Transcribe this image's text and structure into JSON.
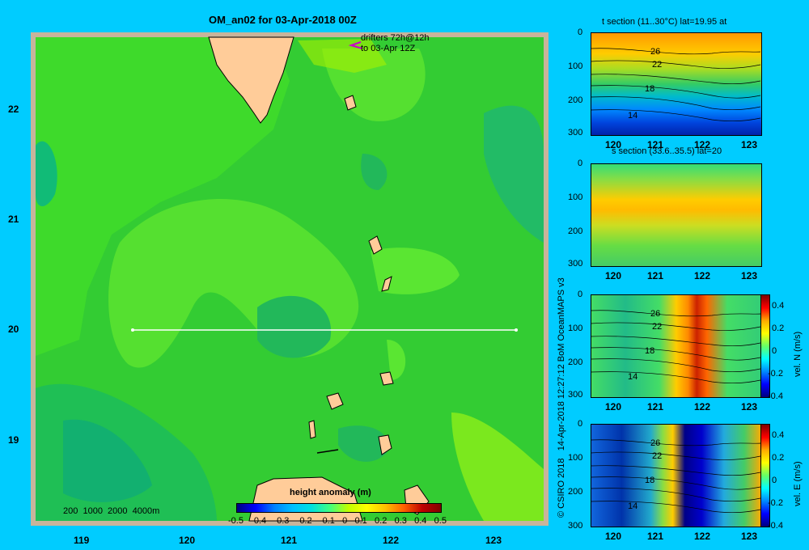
{
  "map": {
    "title": "OM_an02 for 03-Apr-2018 00Z",
    "drifters_line1": "drifters 72h@12h",
    "drifters_line2": "to 03-Apr 12Z",
    "lat_ticks": [
      "22",
      "21",
      "20",
      "19"
    ],
    "lon_ticks": [
      "119",
      "120",
      "121",
      "122",
      "123"
    ],
    "depth_legend": "200  1000  2000  4000m",
    "colorbar_title": "height anomaly (m)",
    "colorbar_ticks": [
      "-0.5",
      "-0.4",
      "-0.3",
      "-0.2",
      "-0.1",
      "0",
      "0.1",
      "0.2",
      "0.3",
      "0.4",
      "0.5"
    ]
  },
  "sections": [
    {
      "title": "t section (11..30°C) lat=19.95 at",
      "depth_ticks": [
        "0",
        "100",
        "200",
        "300"
      ],
      "lon_ticks": [
        "120",
        "121",
        "122",
        "123"
      ],
      "contour_labels": [
        "26",
        "22",
        "18",
        "14"
      ],
      "colorbar": null
    },
    {
      "title": "s section (33.6..35.5) lat=20",
      "depth_ticks": [
        "0",
        "100",
        "200",
        "300"
      ],
      "lon_ticks": [
        "120",
        "121",
        "122",
        "123"
      ],
      "contour_labels": [],
      "colorbar": null
    },
    {
      "title": "",
      "depth_ticks": [
        "0",
        "100",
        "200",
        "300"
      ],
      "lon_ticks": [
        "120",
        "121",
        "122",
        "123"
      ],
      "contour_labels": [
        "26",
        "22",
        "18",
        "14"
      ],
      "colorbar": {
        "label": "vel. N (m/s)",
        "ticks": [
          "0.4",
          "0.2",
          "0",
          "-0.2",
          "-0.4"
        ]
      }
    },
    {
      "title": "",
      "depth_ticks": [
        "0",
        "100",
        "200",
        "300"
      ],
      "lon_ticks": [
        "120",
        "121",
        "122",
        "123"
      ],
      "contour_labels": [
        "26",
        "22",
        "18",
        "14"
      ],
      "colorbar": {
        "label": "vel. E (m/s)",
        "ticks": [
          "0.4",
          "0.2",
          "0",
          "-0.2",
          "-0.4"
        ]
      }
    }
  ],
  "credit": "© CSIRO 2018   14-Apr-2018 12:27:12 BoM OceanMAPS v3"
}
